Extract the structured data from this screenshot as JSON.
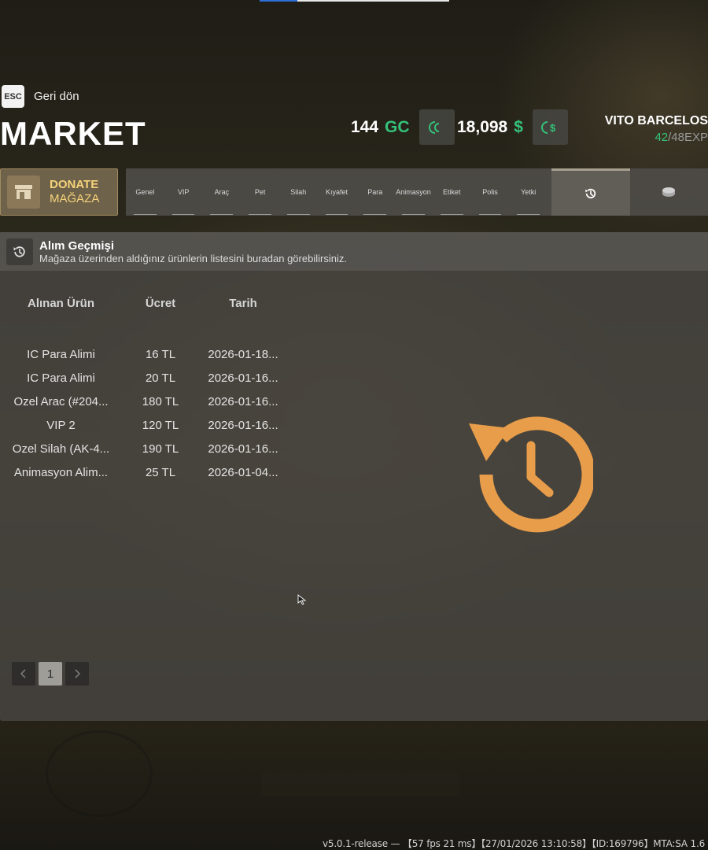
{
  "header": {
    "esc_key": "ESC",
    "back_label": "Geri dön",
    "title": "MARKET"
  },
  "currency": {
    "gc_value": "144",
    "gc_unit": "GC",
    "cash_value": "18,098",
    "cash_unit": "$"
  },
  "player": {
    "name": "VITO BARCELOS",
    "exp_current": "42",
    "exp_rest": "/48EXP"
  },
  "donate": {
    "line1": "DONATE",
    "line2": "MAĞAZA"
  },
  "tabs": [
    {
      "label": "Genel"
    },
    {
      "label": "VIP"
    },
    {
      "label": "Araç"
    },
    {
      "label": "Pet"
    },
    {
      "label": "Silah"
    },
    {
      "label": "Kıyafet"
    },
    {
      "label": "Para"
    },
    {
      "label": "Animasyon"
    },
    {
      "label": "Etiket"
    },
    {
      "label": "Polis"
    },
    {
      "label": "Yetki"
    }
  ],
  "panel": {
    "title": "Alım Geçmişi",
    "subtitle": "Mağaza üzerinden aldığınız ürünlerin listesini buradan görebilirsiniz.",
    "columns": [
      "Alınan Ürün",
      "Ücret",
      "Tarih"
    ],
    "rows": [
      [
        "IC Para Alimi",
        "16 TL",
        "2026-01-18..."
      ],
      [
        "IC Para Alimi",
        "20 TL",
        "2026-01-16..."
      ],
      [
        "Ozel Arac (#204...",
        "180 TL",
        "2026-01-16..."
      ],
      [
        "VIP 2",
        "120 TL",
        "2026-01-16..."
      ],
      [
        "Ozel Silah (AK-4...",
        "190 TL",
        "2026-01-16..."
      ],
      [
        "Animasyon Alim...",
        "25 TL",
        "2026-01-04..."
      ]
    ],
    "pager": {
      "current": "1"
    }
  },
  "colors": {
    "accent_green": "#34c27a",
    "history_orange": "#e89d4a",
    "donate_gold": "#f5d37a"
  },
  "footer": {
    "version": "v5.0.1-release — 【57 fps 21 ms】【27/01/2026 13:10:58】【ID:169796】MTA:SA 1.6"
  }
}
